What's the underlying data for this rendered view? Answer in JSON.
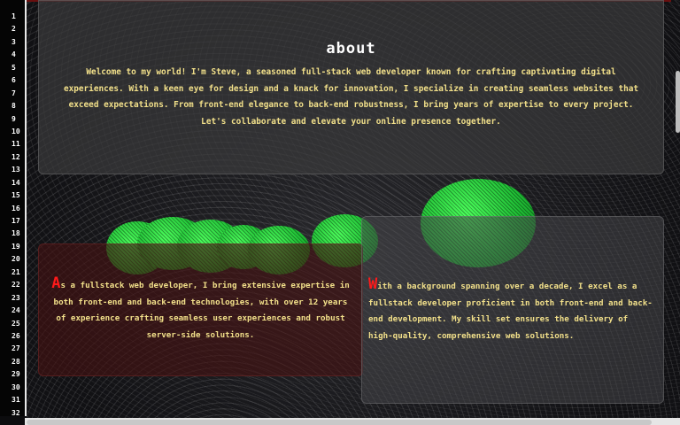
{
  "gutter": {
    "line_numbers": [
      "1",
      "2",
      "3",
      "4",
      "5",
      "6",
      "7",
      "8",
      "9",
      "10",
      "11",
      "12",
      "13",
      "14",
      "15",
      "16",
      "17",
      "18",
      "19",
      "20",
      "21",
      "22",
      "23",
      "24",
      "25",
      "26",
      "27",
      "28",
      "29",
      "30",
      "31",
      "32"
    ]
  },
  "about": {
    "title": "about",
    "text": "Welcome to my world! I'm Steve, a seasoned full-stack web developer known for crafting captivating digital experiences. With a keen eye for design and a knack for innovation, I specialize in creating seamless websites that exceed expectations. From front-end elegance to back-end robustness, I bring years of expertise to every project. Let's collaborate and elevate your online presence together."
  },
  "cards": {
    "left": {
      "initial": "A",
      "text": "s a fullstack web developer, I bring extensive expertise in both front-end and back-end technologies, with over 12 years of experience crafting seamless user experiences and robust server-side solutions."
    },
    "right": {
      "initial": "W",
      "text": "ith a background spanning over a decade, I excel as a fullstack developer proficient in both front-end and back-end development. My skill set ensures the delivery of high-quality, comprehensive web solutions."
    }
  },
  "colors": {
    "accent_red": "#ff1a1a",
    "text_yellow": "#f2e08a",
    "blob_green": "#2fd646"
  }
}
